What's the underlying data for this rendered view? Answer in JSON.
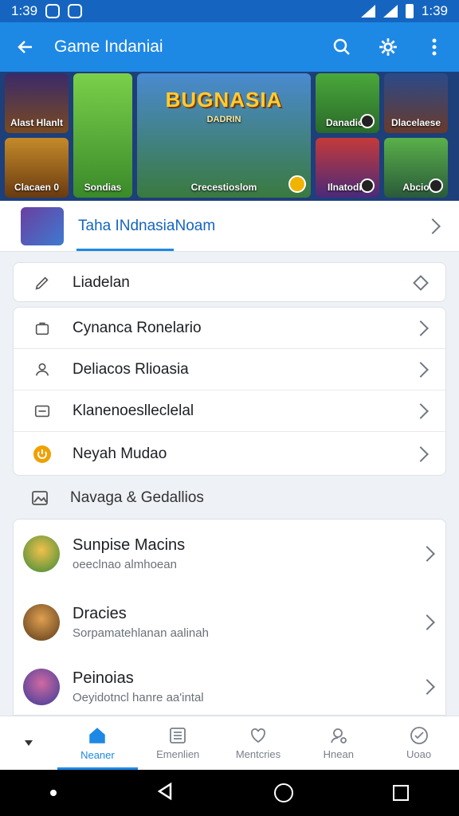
{
  "status_bar": {
    "time_left": "1:39",
    "time_right": "1:39"
  },
  "app_bar": {
    "title": "Game Indaniai"
  },
  "banner": {
    "tiles": [
      {
        "label": "Alast Hlanlt"
      },
      {
        "label": "Clacaen 0"
      },
      {
        "label": "Sondias"
      },
      {
        "label": "BUGNASIA",
        "sub": "DADRIN",
        "caption": "Crecestioslom"
      },
      {
        "label": "Danadios"
      },
      {
        "label": "Dlacelaese"
      },
      {
        "label": "Ilnatodin"
      },
      {
        "label": "Abcio"
      }
    ]
  },
  "feature": {
    "label": "Taha INdnasiaNoam"
  },
  "leaderboard": {
    "label": "Liadelan"
  },
  "menu": [
    {
      "label": "Cynanca Ronelario",
      "icon": "bag-icon"
    },
    {
      "label": "Deliacos Rlioasia",
      "icon": "users-icon"
    },
    {
      "label": "Klanenoeslleclelal",
      "icon": "card-icon"
    },
    {
      "label": "Neyah Mudao",
      "icon": "power-icon"
    }
  ],
  "section": {
    "label": "Navaga & Gedallios",
    "icon": "gallery-icon"
  },
  "games": [
    {
      "name": "Sunpise Macins",
      "desc": "oeeclnao almhoean"
    },
    {
      "name": "Dracies",
      "desc": "Sorpamatehlanan aalinah"
    },
    {
      "name": "Peinoias",
      "desc": "Oeyidotncl hanre aa'intal"
    }
  ],
  "bottom_nav": {
    "items": [
      {
        "label": "Neaner",
        "icon": "home-icon"
      },
      {
        "label": "Emenlien",
        "icon": "list-icon"
      },
      {
        "label": "Mentcries",
        "icon": "heart-icon"
      },
      {
        "label": "Hnean",
        "icon": "profile-icon"
      },
      {
        "label": "Uoao",
        "icon": "check-icon"
      }
    ]
  },
  "colors": {
    "primary": "#1e88e5",
    "status": "#1565c0",
    "accent": "#f0a000"
  }
}
